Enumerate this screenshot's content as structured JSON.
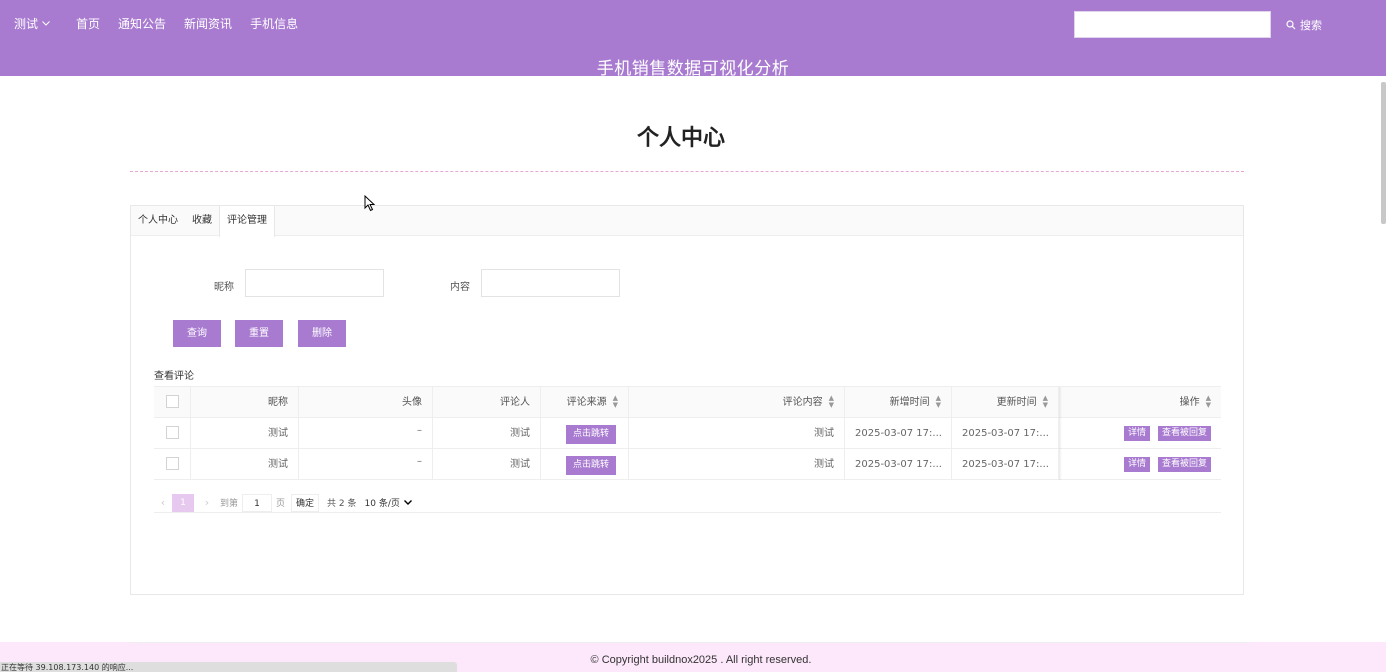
{
  "header": {
    "user_menu": "测试",
    "nav": [
      "首页",
      "通知公告",
      "新闻资讯",
      "手机信息"
    ],
    "search_value": "",
    "search_label": "搜索",
    "site_title": "手机销售数据可视化分析",
    "bg_color": "#a87bd0"
  },
  "page": {
    "title": "个人中心"
  },
  "tabs": [
    {
      "label": "个人中心",
      "active": false
    },
    {
      "label": "收藏",
      "active": false
    },
    {
      "label": "评论管理",
      "active": true
    }
  ],
  "filters": {
    "nickname_label": "昵称",
    "nickname_value": "",
    "content_label": "内容",
    "content_value": ""
  },
  "buttons": {
    "query": "查询",
    "reset": "重置",
    "delete": "删除"
  },
  "table": {
    "section_label": "查看评论",
    "headers": [
      "昵称",
      "头像",
      "评论人",
      "评论来源",
      "评论内容",
      "新增时间",
      "更新时间",
      "操作"
    ],
    "rows": [
      {
        "nickname": "测试",
        "avatar": "–",
        "commenter": "测试",
        "source_btn": "点击跳转",
        "content": "测试",
        "created": "2025-03-07 17:...",
        "updated": "2025-03-07 17:...",
        "detail_btn": "详情",
        "reply_btn": "查看被回复"
      },
      {
        "nickname": "测试",
        "avatar": "–",
        "commenter": "测试",
        "source_btn": "点击跳转",
        "content": "测试",
        "created": "2025-03-07 17:...",
        "updated": "2025-03-07 17:...",
        "detail_btn": "详情",
        "reply_btn": "查看被回复"
      }
    ]
  },
  "pagination": {
    "prev": "‹",
    "current_page": "1",
    "next": "›",
    "goto_label": "到第",
    "goto_value": "1",
    "page_unit": "页",
    "confirm": "确定",
    "total": "共 2 条",
    "page_size": "10 条/页"
  },
  "footer": {
    "copyright": "© Copyright buildnox2025 . All right reserved.",
    "status": "正在等待 39.108.173.140 的响应..."
  }
}
